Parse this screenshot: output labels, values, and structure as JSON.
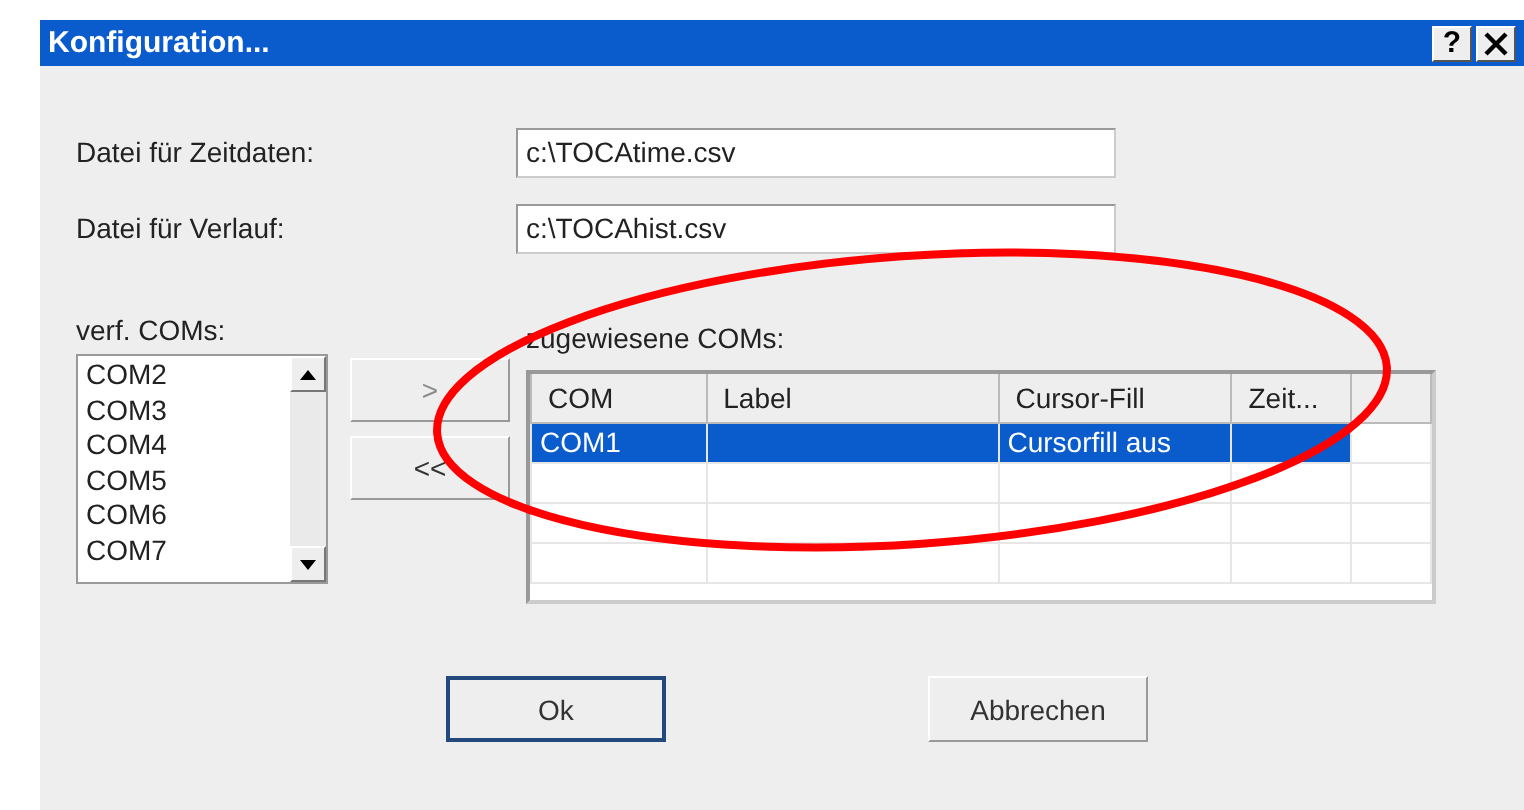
{
  "window": {
    "title": "Konfiguration...",
    "help_button": "?"
  },
  "fields": [
    {
      "label": "Datei für Zeitdaten:",
      "value": "c:\\TOCAtime.csv"
    },
    {
      "label": "Datei für Verlauf:",
      "value": "c:\\TOCAhist.csv"
    }
  ],
  "available": {
    "label": "verf. COMs:",
    "items": [
      "COM2",
      "COM3",
      "COM4",
      "COM5",
      "COM6",
      "COM7"
    ]
  },
  "move_buttons": [
    {
      "label": ">",
      "disabled": true
    },
    {
      "label": "<<",
      "disabled": false
    }
  ],
  "assigned": {
    "label": "zugewiesene COMs:",
    "columns": [
      "COM",
      "Label",
      "Cursor-Fill",
      "Zeit..."
    ],
    "rows": [
      {
        "cells": [
          "COM1",
          "",
          "Cursorfill aus",
          ""
        ],
        "selected": true
      }
    ]
  },
  "buttons": [
    {
      "label": "Ok",
      "default": true
    },
    {
      "label": "Abbrechen",
      "default": false
    }
  ],
  "annotation": {
    "kind": "ellipse",
    "color": "#ff0000"
  }
}
